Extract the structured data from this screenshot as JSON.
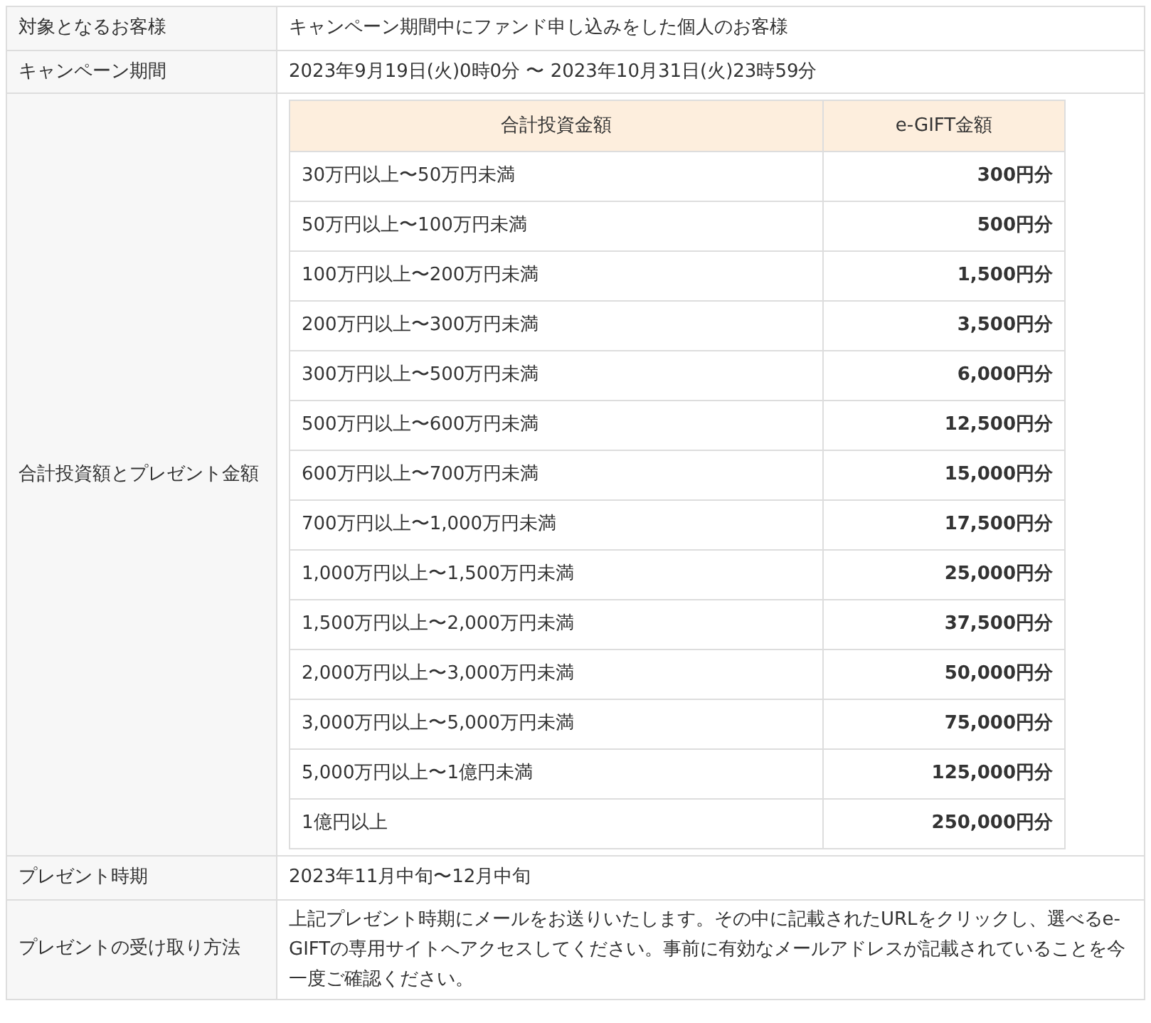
{
  "rows": [
    {
      "label": "対象となるお客様",
      "kind": "text",
      "value": "キャンペーン期間中にファンド申し込みをした個人のお客様"
    },
    {
      "label": "キャンペーン期間",
      "kind": "text",
      "value": "2023年9月19日(火)0時0分 〜 2023年10月31日(火)23時59分"
    },
    {
      "label": "合計投資額とプレゼント金額",
      "kind": "table",
      "table": {
        "columns": [
          "合計投資金額",
          "e-GIFT金額"
        ],
        "rows": [
          [
            "30万円以上〜50万円未満",
            "300円分"
          ],
          [
            "50万円以上〜100万円未満",
            "500円分"
          ],
          [
            "100万円以上〜200万円未満",
            "1,500円分"
          ],
          [
            "200万円以上〜300万円未満",
            "3,500円分"
          ],
          [
            "300万円以上〜500万円未満",
            "6,000円分"
          ],
          [
            "500万円以上〜600万円未満",
            "12,500円分"
          ],
          [
            "600万円以上〜700万円未満",
            "15,000円分"
          ],
          [
            "700万円以上〜1,000万円未満",
            "17,500円分"
          ],
          [
            "1,000万円以上〜1,500万円未満",
            "25,000円分"
          ],
          [
            "1,500万円以上〜2,000万円未満",
            "37,500円分"
          ],
          [
            "2,000万円以上〜3,000万円未満",
            "50,000円分"
          ],
          [
            "3,000万円以上〜5,000万円未満",
            "75,000円分"
          ],
          [
            "5,000万円以上〜1億円未満",
            "125,000円分"
          ],
          [
            "1億円以上",
            "250,000円分"
          ]
        ]
      }
    },
    {
      "label": "プレゼント時期",
      "kind": "text",
      "value": "2023年11月中旬〜12月中旬"
    },
    {
      "label": "プレゼントの受け取り方法",
      "kind": "text",
      "value": "上記プレゼント時期にメールをお送りいたします。その中に記載されたURLをクリックし、選べるe-GIFTの専用サイトへアクセスしてください。事前に有効なメールアドレスが記載されていることを今一度ご確認ください。"
    }
  ]
}
